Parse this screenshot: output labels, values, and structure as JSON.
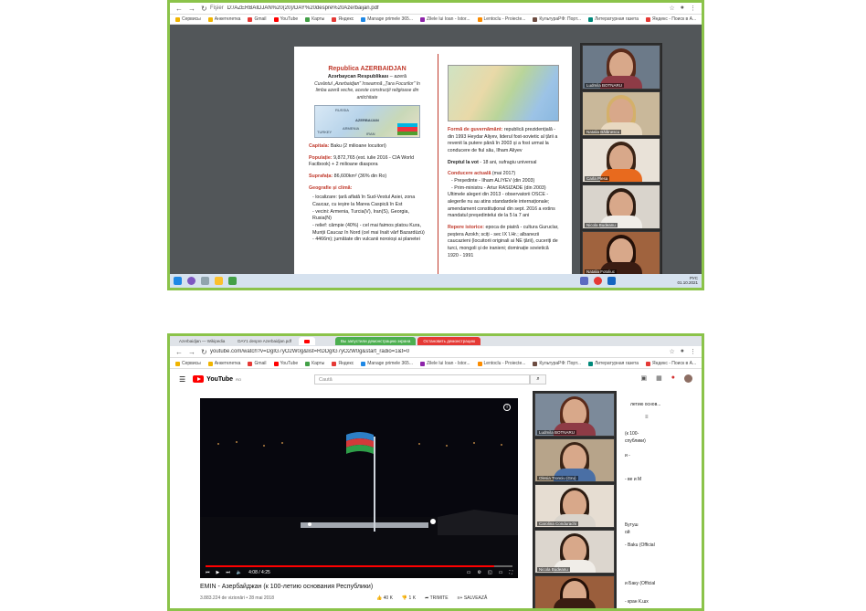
{
  "shot1": {
    "address": {
      "tab_label": "Fişier",
      "url": "D:/AZERBAIDJAN%20(20)/DAY%20despre%20Azerbaijan.pdf"
    },
    "bookmarks": [
      "Сервисы",
      "Анкетелетка",
      "Gmail",
      "YouTube",
      "Карты",
      "Яндекс",
      "Manage primele 365...",
      "Zilele lui Ioan - Istor...",
      "Lentoclu - Proiecte...",
      "КультураРФ: Порт...",
      "Литературная газета",
      "Яндекс - Поиск в А..."
    ],
    "pdf": {
      "title": "Republica AZERBAIDJAN",
      "subtitle_bold": "Azərbaycan Respublikası",
      "subtitle_rest": " – azeră",
      "italic_note": "Cuvântul „Azerbaidjan\" înseamnă „Țara Focurilor\" în limba azeră veche, aceste construcții religioase din antichitate",
      "map_labels": [
        "RUSSIA",
        "AZERBAIJAN",
        "ARMENIA",
        "TURKEY",
        "IRAN"
      ],
      "left_paragraphs": [
        {
          "label": "Capitala:",
          "text": " Baku (2 milioane locuitori)"
        },
        {
          "label": "Populație:",
          "text": " 9,872,765 (est. iulie 2016 - CIA World Factbook) + 2 milioane diaspora"
        },
        {
          "label": "Suprafața:",
          "text": " 86,600km² (36% din Ro)"
        },
        {
          "label": "Geografie și climă:",
          "text": ""
        }
      ],
      "left_bullets": [
        "- localizare: țară aflată în Sud-Vestul Asiei, zona Caucaz, cu ieșire la Marea Caspică în Est",
        "- vecini: Armenia, Turcia(V), Iran(S), Georgia, Rusia(N)",
        "- relief: câmpie (40%) - cel mai faimos platou Kura, Munții Caucaz în Nord (cel mai înalt vârf Bazardüzü)",
        "- 4466m); jumătate din vulcanii noroioși ai planetei"
      ],
      "right_paragraphs": [
        {
          "label": "Formă de guvernământ:",
          "text": " republică prezidențială - din 1993 Heydar Aliyev, liderul fost-sovietic al țării a revenit la putere până în 2003 și a fost urmat la conducere de fiul său, Ilham Aliyev"
        },
        {
          "label": "Dreptul la vot",
          "text": " - 18 ani, sufragiu universal"
        },
        {
          "label": "Conducere actuală",
          "text": " (mai 2017)"
        }
      ],
      "right_bullets": [
        "- Președinte - Ilham ALIYEV (din 2003)",
        "- Prim-ministru - Artur RASIZADE (din 2003)",
        "Ultimele alegeri din 2013 - observatorii OSCE - alegerile nu au atins standardele internaționale; amendament constituțional din sept. 2016 a extins mandatul președintelui de la 5 la 7 ani"
      ],
      "history": {
        "label": "Repere istorice:",
        "text": " epoca de piatră - cultura Guruclar, peștera Azokh; sciți - sec IX î.Hr.; albanezii caucazieni (locuitorii originali ai NE țării), cuceriți de turci, mongoli și de iranieni; dominație sovietică 1920 - 1991"
      }
    },
    "participants": [
      {
        "name": "Ludmila BOTNARU"
      },
      {
        "name": "Natalia Bălănescu"
      },
      {
        "name": "Carla Plesa"
      },
      {
        "name": "Nicola Budeanu"
      },
      {
        "name": "Natalia Fotoliuc"
      }
    ],
    "taskbar": {
      "lang": "РУС",
      "time": "01.10.2021"
    }
  },
  "shot2": {
    "tabs": [
      "Azerbaidjan — Wikipedia",
      "DAY1 despre Azerbaidjan.pdf",
      "",
      "Вы запустили демонстрацию экрана",
      "Остановить демонстрацию"
    ],
    "address": {
      "url": "youtube.com/watch?v=DgIG7yO2W0g&list=RDDgIG7yO2W0g&start_radio=1&t=0"
    },
    "bookmarks": [
      "Сервисы",
      "Анкетелетка",
      "Gmail",
      "YouTube",
      "Карты",
      "Яндекс",
      "Manage primele 365...",
      "Zilele lui Ioan - Istor...",
      "Lentoclu - Proiecte...",
      "КультураРФ: Порт...",
      "Литературная газета",
      "Яндекс - Поиск в А..."
    ],
    "youtube": {
      "logo": "YouTube",
      "logo_sup": "RO",
      "search_placeholder": "Caută",
      "time": "4:08 / 4:25",
      "progress": 0.94,
      "video_title": "EMIN - Азербайджан (к 100-летию основания Республики)",
      "views": "3.883.224 de vizionări • 28 mai 2018",
      "likes": "40 K",
      "dislikes": "1 K",
      "share": "TRIMITE",
      "save": "SALVEAZĂ",
      "side_items": [
        "летию основ...",
        "(к 100-",
        "спублики)",
        "",
        "и -",
        "",
        "- ве и М",
        "",
        "",
        "Бутуш",
        "ой",
        "",
        "- Baku (Official",
        "",
        "",
        "",
        "",
        "",
        "",
        "и Баку (Official",
        "",
        "- кран К.шх"
      ]
    },
    "participants": [
      {
        "name": "Ludmila BOTNARU"
      },
      {
        "name": "Olesia Tronciu (Gru)"
      },
      {
        "name": "Carolina Condurachi"
      },
      {
        "name": "Nicola Budeanu"
      },
      {
        "name": ""
      }
    ]
  }
}
